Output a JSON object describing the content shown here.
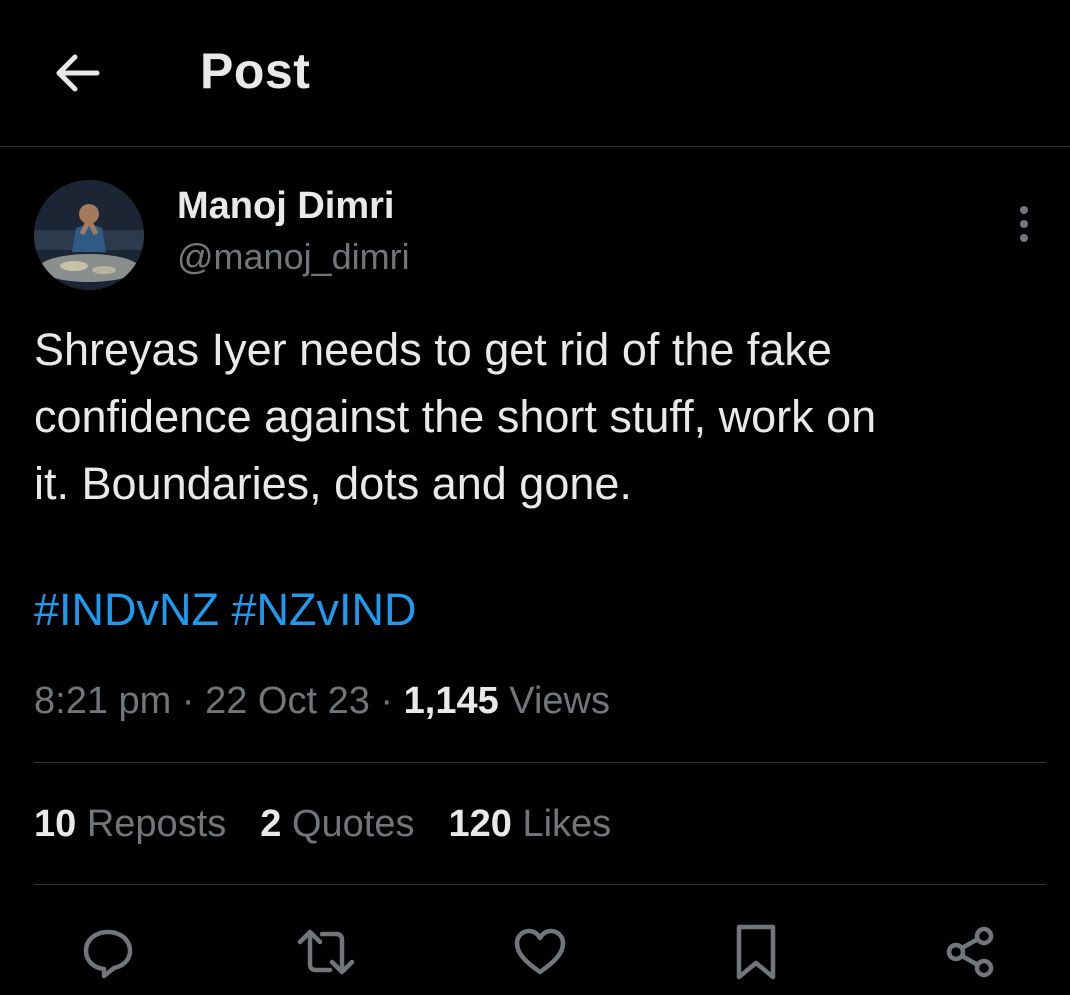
{
  "header": {
    "title": "Post"
  },
  "author": {
    "name": "Manoj Dimri",
    "handle": "@manoj_dimri"
  },
  "post": {
    "text": "Shreyas Iyer needs to get rid of the fake\nconfidence against the short stuff, work on\nit. Boundaries, dots and gone.",
    "hashtags": [
      "#INDvNZ",
      "#NZvIND"
    ],
    "time": "8:21 pm",
    "date": "22 Oct 23",
    "separator": "·",
    "views_count": "1,145",
    "views_label": "Views"
  },
  "stats": {
    "reposts_count": "10",
    "reposts_label": "Reposts",
    "quotes_count": "2",
    "quotes_label": "Quotes",
    "likes_count": "120",
    "likes_label": "Likes"
  },
  "icons": {
    "back": "arrow-left-icon",
    "more": "more-vertical-icon",
    "reply": "reply-icon",
    "repost": "repost-icon",
    "like": "heart-icon",
    "bookmark": "bookmark-icon",
    "share": "share-icon"
  },
  "colors": {
    "background": "#000000",
    "text": "#e7e9ea",
    "muted": "#71767b",
    "link": "#1d9bf0",
    "divider": "#2f3336"
  }
}
